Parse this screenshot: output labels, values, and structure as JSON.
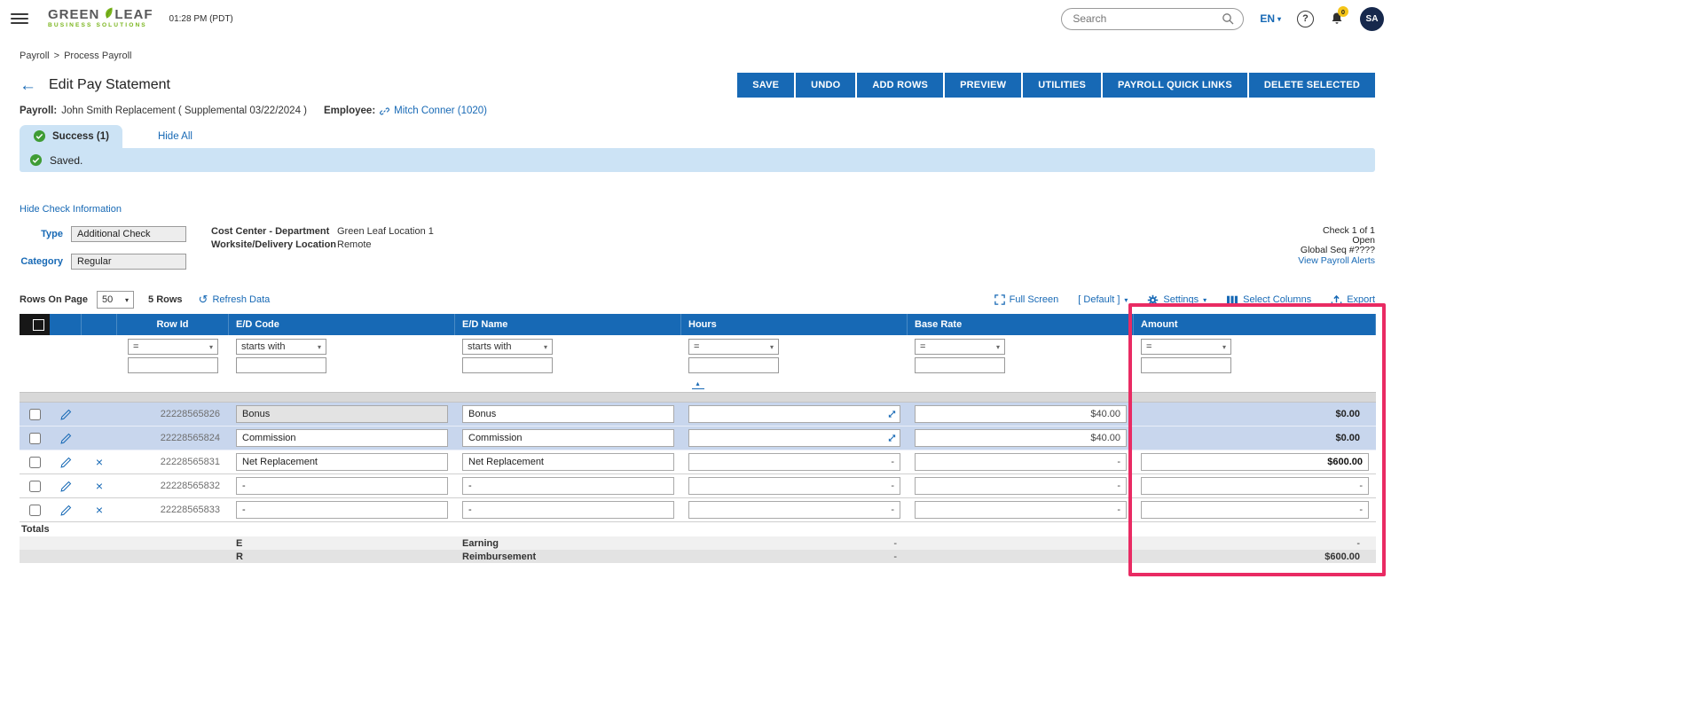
{
  "topbar": {
    "logo": {
      "word1": "GREEN",
      "word2": "LEAF",
      "subtitle": "BUSINESS SOLUTIONS"
    },
    "time": "01:28 PM (PDT)",
    "search_placeholder": "Search",
    "language": "EN",
    "notification_badge": "0",
    "avatar_initials": "SA"
  },
  "breadcrumb": {
    "item1": "Payroll",
    "separator": ">",
    "item2": "Process Payroll"
  },
  "header": {
    "title": "Edit Pay Statement",
    "buttons": [
      "SAVE",
      "UNDO",
      "ADD ROWS",
      "PREVIEW",
      "UTILITIES",
      "PAYROLL QUICK LINKS",
      "DELETE SELECTED"
    ]
  },
  "context": {
    "payroll_label": "Payroll:",
    "payroll_value": "John Smith Replacement ( Supplemental 03/22/2024 )",
    "employee_label": "Employee:",
    "employee_link": "Mitch Conner (1020)"
  },
  "alerts": {
    "success_tab": "Success (1)",
    "hide_all": "Hide All",
    "saved_message": "Saved."
  },
  "check_info": {
    "toggle_link": "Hide Check Information",
    "type_label": "Type",
    "type_value": "Additional Check",
    "category_label": "Category",
    "category_value": "Regular",
    "cost_center_label": "Cost Center - Department",
    "cost_center_value": "Green Leaf Location 1",
    "worksite_label": "Worksite/Delivery Location",
    "worksite_value": "Remote",
    "check_count": "Check 1 of 1",
    "check_status": "Open",
    "global_seq": "Global Seq #????",
    "payroll_alerts_link": "View Payroll Alerts"
  },
  "grid_toolbar": {
    "rows_on_page_label": "Rows On Page",
    "rows_on_page_value": "50",
    "row_count": "5 Rows",
    "refresh_label": "Refresh Data",
    "full_screen_label": "Full Screen",
    "view_selector": "[ Default ]",
    "settings_label": "Settings",
    "select_columns_label": "Select Columns",
    "export_label": "Export"
  },
  "grid": {
    "columns": [
      "Row Id",
      "E/D Code",
      "E/D Name",
      "Hours",
      "Base Rate",
      "Amount"
    ],
    "filter_ops": [
      "=",
      "starts with",
      "starts with",
      "=",
      "=",
      "="
    ],
    "rows": [
      {
        "row_id": "22228565826",
        "ed_code": "Bonus",
        "ed_name": "Bonus",
        "hours": "",
        "base_rate": "$40.00",
        "amount": "$0.00"
      },
      {
        "row_id": "22228565824",
        "ed_code": "Commission",
        "ed_name": "Commission",
        "hours": "",
        "base_rate": "$40.00",
        "amount": "$0.00"
      },
      {
        "row_id": "22228565831",
        "ed_code": "Net Replacement",
        "ed_name": "Net Replacement",
        "hours": "-",
        "base_rate": "-",
        "amount": "$600.00"
      },
      {
        "row_id": "22228565832",
        "ed_code": "-",
        "ed_name": "-",
        "hours": "-",
        "base_rate": "-",
        "amount": "-"
      },
      {
        "row_id": "22228565833",
        "ed_code": "-",
        "ed_name": "-",
        "hours": "-",
        "base_rate": "-",
        "amount": "-"
      }
    ],
    "totals": {
      "label": "Totals",
      "earning_code": "E",
      "earning_name": "Earning",
      "earning_hours": "-",
      "earning_amount": "-",
      "reimb_code": "R",
      "reimb_name": "Reimbursement",
      "reimb_hours": "-",
      "reimb_amount": "$600.00"
    }
  }
}
